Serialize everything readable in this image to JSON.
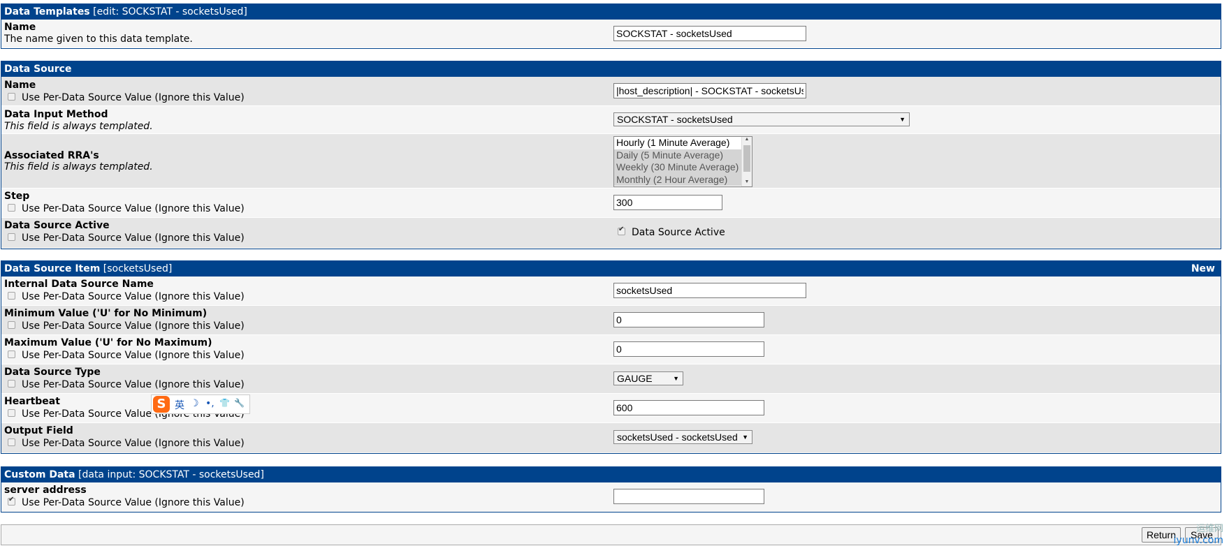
{
  "data_template": {
    "header_bold": "Data Templates",
    "header_rest": " [edit: SOCKSTAT - socketsUsed]",
    "name_title": "Name",
    "name_desc": "The name given to this data template.",
    "name_value": "SOCKSTAT - socketsUsed"
  },
  "data_source": {
    "header": "Data Source",
    "per_ds_label": "Use Per-Data Source Value (Ignore this Value)",
    "name_title": "Name",
    "name_value": "|host_description| - SOCKSTAT - socketsUsed",
    "dim_title": "Data Input Method",
    "dim_note": "This field is always templated.",
    "dim_value": "SOCKSTAT - socketsUsed",
    "rra_title": "Associated RRA's",
    "rra_note": "This field is always templated.",
    "rra_options": [
      "Hourly (1 Minute Average)",
      "Daily (5 Minute Average)",
      "Weekly (30 Minute Average)",
      "Monthly (2 Hour Average)"
    ],
    "step_title": "Step",
    "step_value": "300",
    "active_title": "Data Source Active",
    "active_label": "Data Source Active"
  },
  "ds_item": {
    "header_bold": "Data Source Item",
    "header_rest": " [socketsUsed]",
    "header_right": "New",
    "internal_title": "Internal Data Source Name",
    "internal_value": "socketsUsed",
    "min_title": "Minimum Value ('U' for No Minimum)",
    "min_value": "0",
    "max_title": "Maximum Value ('U' for No Maximum)",
    "max_value": "0",
    "type_title": "Data Source Type",
    "type_value": "GAUGE",
    "heartbeat_title": "Heartbeat",
    "heartbeat_value": "600",
    "output_title": "Output Field",
    "output_value": "socketsUsed - socketsUsed"
  },
  "custom_data": {
    "header_bold": "Custom Data",
    "header_rest": " [data input: SOCKSTAT - socketsUsed]",
    "server_title": "server address",
    "server_value": ""
  },
  "ime": {
    "logo": "S",
    "lang": "英",
    "moon": "☽",
    "dot": "•,",
    "shirt": "👕",
    "tool": "🔧"
  },
  "buttons": {
    "return": "Return",
    "save": "Save"
  },
  "watermark": {
    "cn": "运维网",
    "url": "iyunv.com"
  },
  "colors": {
    "header_bg": "#00438c",
    "row_light": "#f5f5f5",
    "row_dark": "#e5e5e5"
  }
}
